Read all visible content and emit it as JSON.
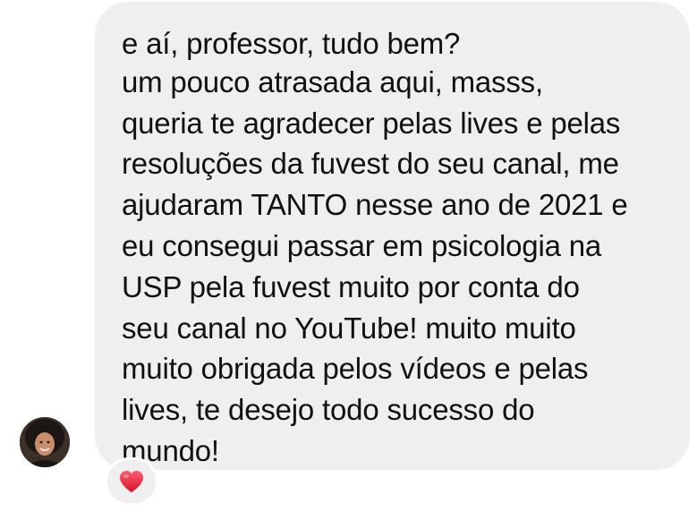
{
  "message": {
    "lines": [
      "e aí, professor, tudo bem?",
      "um pouco atrasada aqui, masss,",
      "queria te agradecer pelas lives e pelas",
      "resoluções da fuvest do seu canal, me",
      "ajudaram TANTO nesse ano de 2021 e",
      "eu consegui passar em psicologia na",
      "USP pela fuvest muito por conta do",
      "seu canal no YouTube! muito muito",
      "muito obrigada pelos vídeos e pelas",
      "lives, te desejo todo sucesso do",
      "mundo!"
    ]
  },
  "reaction": {
    "icon": "heart-icon",
    "color": "#e0203a"
  },
  "colors": {
    "bubble": "#efefef",
    "text": "#111111",
    "background": "#ffffff"
  }
}
